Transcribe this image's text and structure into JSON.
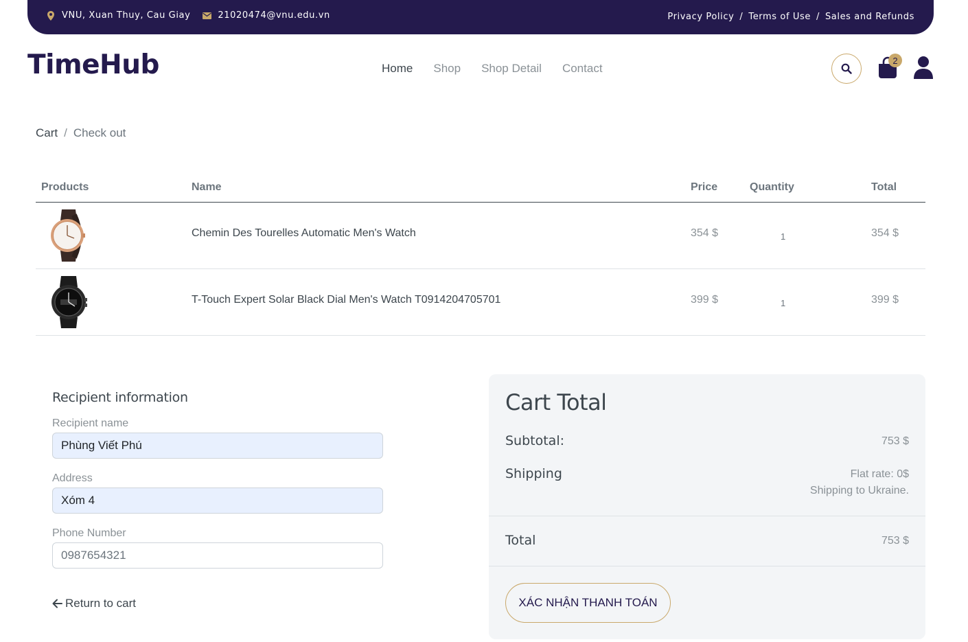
{
  "topbar": {
    "location": "VNU, Xuan Thuy, Cau Giay",
    "email": "21020474@vnu.edu.vn",
    "links": [
      "Privacy Policy",
      "Terms of Use",
      "Sales and Refunds"
    ],
    "separator": "/"
  },
  "header": {
    "logo": "TimeHub",
    "nav": [
      "Home",
      "Shop",
      "Shop Detail",
      "Contact"
    ],
    "cart_count": "2"
  },
  "breadcrumb": {
    "cart": "Cart",
    "separator": "/",
    "current": "Check out"
  },
  "table": {
    "headers": {
      "products": "Products",
      "name": "Name",
      "price": "Price",
      "quantity": "Quantity",
      "total": "Total"
    },
    "rows": [
      {
        "name": "Chemin Des Tourelles Automatic Men's Watch",
        "price": "354 $",
        "quantity": "1",
        "total": "354 $"
      },
      {
        "name": "T-Touch Expert Solar Black Dial Men's Watch T0914204705701",
        "price": "399 $",
        "quantity": "1",
        "total": "399 $"
      }
    ]
  },
  "recipient": {
    "title": "Recipient information",
    "name_label": "Recipient name",
    "name_value": "Phùng Viết Phú",
    "address_label": "Address",
    "address_value": "Xóm 4",
    "phone_label": "Phone Number",
    "phone_value": "0987654321",
    "return_label": "Return to cart"
  },
  "cart_total": {
    "title": "Cart Total",
    "subtotal_label": "Subtotal:",
    "subtotal_value": "753 $",
    "shipping_label": "Shipping",
    "shipping_rate": "Flat rate: 0$",
    "shipping_dest": "Shipping to Ukraine.",
    "total_label": "Total",
    "total_value": "753 $",
    "confirm_label": "XÁC NHẬN THANH TOÁN"
  },
  "colors": {
    "brand_dark": "#241a4d",
    "accent_gold": "#c9a86a",
    "panel_bg": "#f3f5f7",
    "autofill_bg": "#e8f0fe"
  },
  "icons": [
    "map-marker-icon",
    "envelope-icon",
    "search-icon",
    "shopping-bag-icon",
    "user-icon",
    "arrow-left-icon"
  ]
}
